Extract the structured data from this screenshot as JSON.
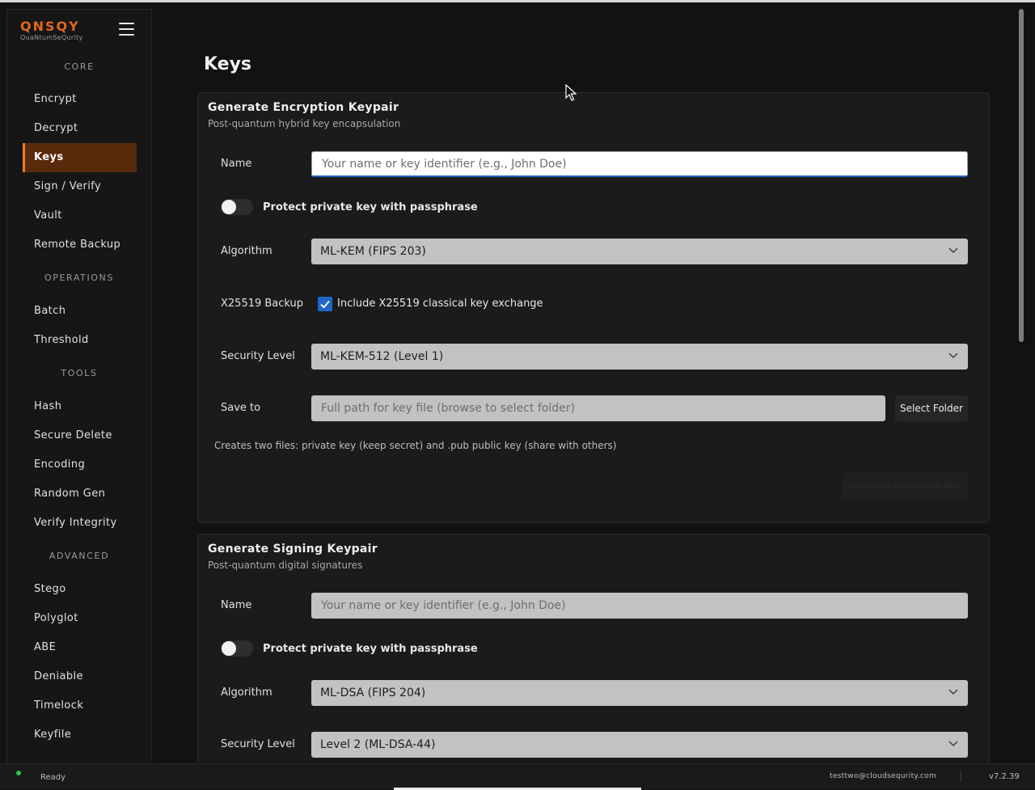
{
  "app": {
    "logo_main": "QNSQY",
    "logo_sub": "QuaNtumSeQurity"
  },
  "sidebar": {
    "sections": [
      {
        "title": "CORE",
        "items": [
          "Encrypt",
          "Decrypt",
          "Keys",
          "Sign / Verify",
          "Vault",
          "Remote Backup"
        ]
      },
      {
        "title": "OPERATIONS",
        "items": [
          "Batch",
          "Threshold"
        ]
      },
      {
        "title": "TOOLS",
        "items": [
          "Hash",
          "Secure Delete",
          "Encoding",
          "Random Gen",
          "Verify Integrity"
        ]
      },
      {
        "title": "ADVANCED",
        "items": [
          "Stego",
          "Polyglot",
          "ABE",
          "Deniable",
          "Timelock",
          "Keyfile"
        ]
      }
    ],
    "active_item": "Keys"
  },
  "page": {
    "title": "Keys"
  },
  "encryption_card": {
    "title": "Generate Encryption Keypair",
    "subtitle": "Post-quantum hybrid key encapsulation",
    "name_label": "Name",
    "name_placeholder": "Your name or key identifier (e.g., John Doe)",
    "name_value": "",
    "protect_label": "Protect private key with passphrase",
    "protect_enabled": false,
    "algorithm_label": "Algorithm",
    "algorithm_value": "ML-KEM (FIPS 203)",
    "x25519_label": "X25519 Backup",
    "x25519_checkbox_label": "Include X25519 classical key exchange",
    "x25519_checked": true,
    "security_label": "Security Level",
    "security_value": "ML-KEM-512 (Level 1)",
    "save_label": "Save to",
    "save_placeholder": "Full path for key file (browse to select folder)",
    "select_folder": "Select Folder",
    "hint": "Creates two files: private key (keep secret) and .pub public key (share with others)",
    "generate_button": "Generate Encryption Key"
  },
  "signing_card": {
    "title": "Generate Signing Keypair",
    "subtitle": "Post-quantum digital signatures",
    "name_label": "Name",
    "name_placeholder": "Your name or key identifier (e.g., John Doe)",
    "protect_label": "Protect private key with passphrase",
    "protect_enabled": false,
    "algorithm_label": "Algorithm",
    "algorithm_value": "ML-DSA (FIPS 204)",
    "security_label": "Security Level",
    "security_value": "Level 2 (ML-DSA-44)"
  },
  "statusbar": {
    "status": "Ready",
    "email": "testtwo@cloudsequrity.com",
    "version": "v7.2.39"
  },
  "colors": {
    "accent": "#f07a24",
    "active_bg": "#5a2a0c",
    "checkbox": "#1f66c8",
    "status_dot": "#2ec44b"
  }
}
